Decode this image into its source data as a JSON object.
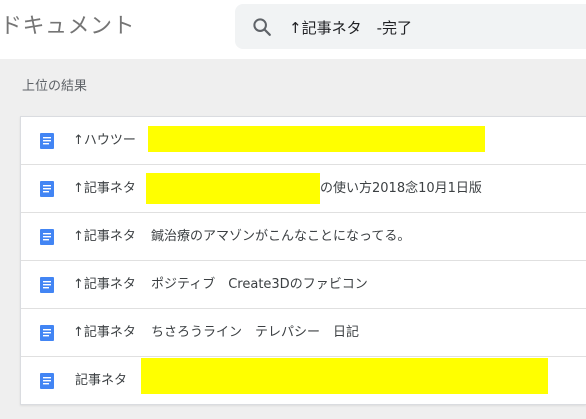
{
  "app": {
    "title": "ドキュメント"
  },
  "search": {
    "query": "↑記事ネタ　-完了",
    "icon": "search-icon"
  },
  "results": {
    "section_label": "上位の結果",
    "doc_icon": "document-icon",
    "doc_icon_color": "#4285f4",
    "redaction_color": "#ffff00",
    "items": [
      {
        "prefix": "↑ハウツー",
        "suffix": ""
      },
      {
        "prefix": "↑記事ネタ",
        "suffix": "の使い方2018念10月1日版"
      },
      {
        "prefix": "↑記事ネタ",
        "suffix": "鍼治療のアマゾンがこんなことになってる。"
      },
      {
        "prefix": "↑記事ネタ",
        "suffix": "ポジティブ　Create3Dのファビコン"
      },
      {
        "prefix": "↑記事ネタ",
        "suffix": "ちさろうライン　テレパシー　日記"
      },
      {
        "prefix": "記事ネタ",
        "suffix": ""
      }
    ]
  }
}
